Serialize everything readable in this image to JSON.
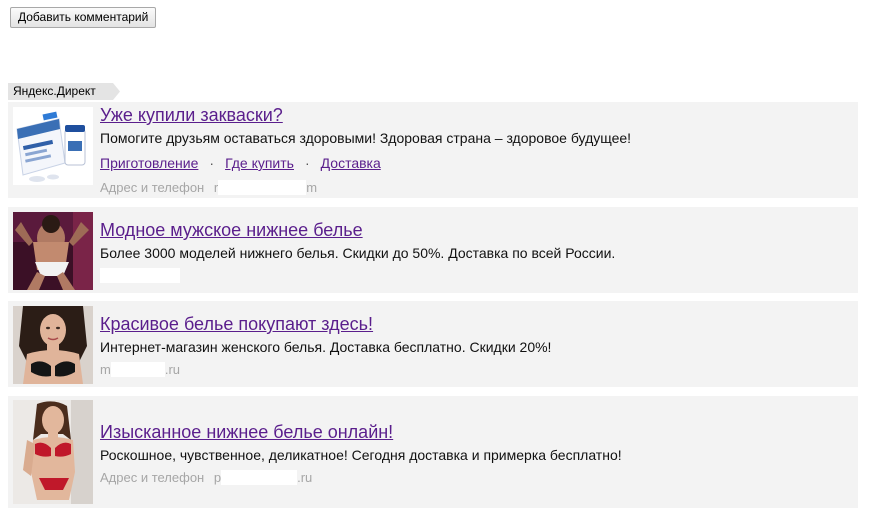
{
  "toolbar": {
    "add_comment_label": "Добавить комментарий"
  },
  "direct": {
    "label": "Яндекс.Директ"
  },
  "ads": [
    {
      "title": "Уже купили закваски?",
      "description": "Помогите друзьям оставаться здоровыми! Здоровая страна – здоровое будущее!",
      "sitelinks": [
        "Приготовление",
        "Где купить",
        "Доставка"
      ],
      "contact_label": "Адрес и телефон",
      "domain_start": "r",
      "domain_end": "m"
    },
    {
      "title": "Модное мужское нижнее белье",
      "description": "Более 3000 моделей нижнего белья. Скидки до 50%. Доставка по всей России."
    },
    {
      "title": "Красивое белье покупают здесь!",
      "description": "Интернет-магазин женского белья. Доставка бесплатно. Скидки 20%!",
      "domain_start": "m",
      "domain_end": ".ru"
    },
    {
      "title": "Изысканное нижнее белье онлайн!",
      "description": "Роскошное, чувственное, деликатное! Сегодня доставка и примерка бесплатно!",
      "contact_label": "Адрес и телефон",
      "domain_start": "p",
      "domain_end": ".ru"
    }
  ],
  "colors": {
    "link": "#5a1e8c",
    "ad_background": "#f3f3f3",
    "muted_text": "#a6a6a6"
  }
}
